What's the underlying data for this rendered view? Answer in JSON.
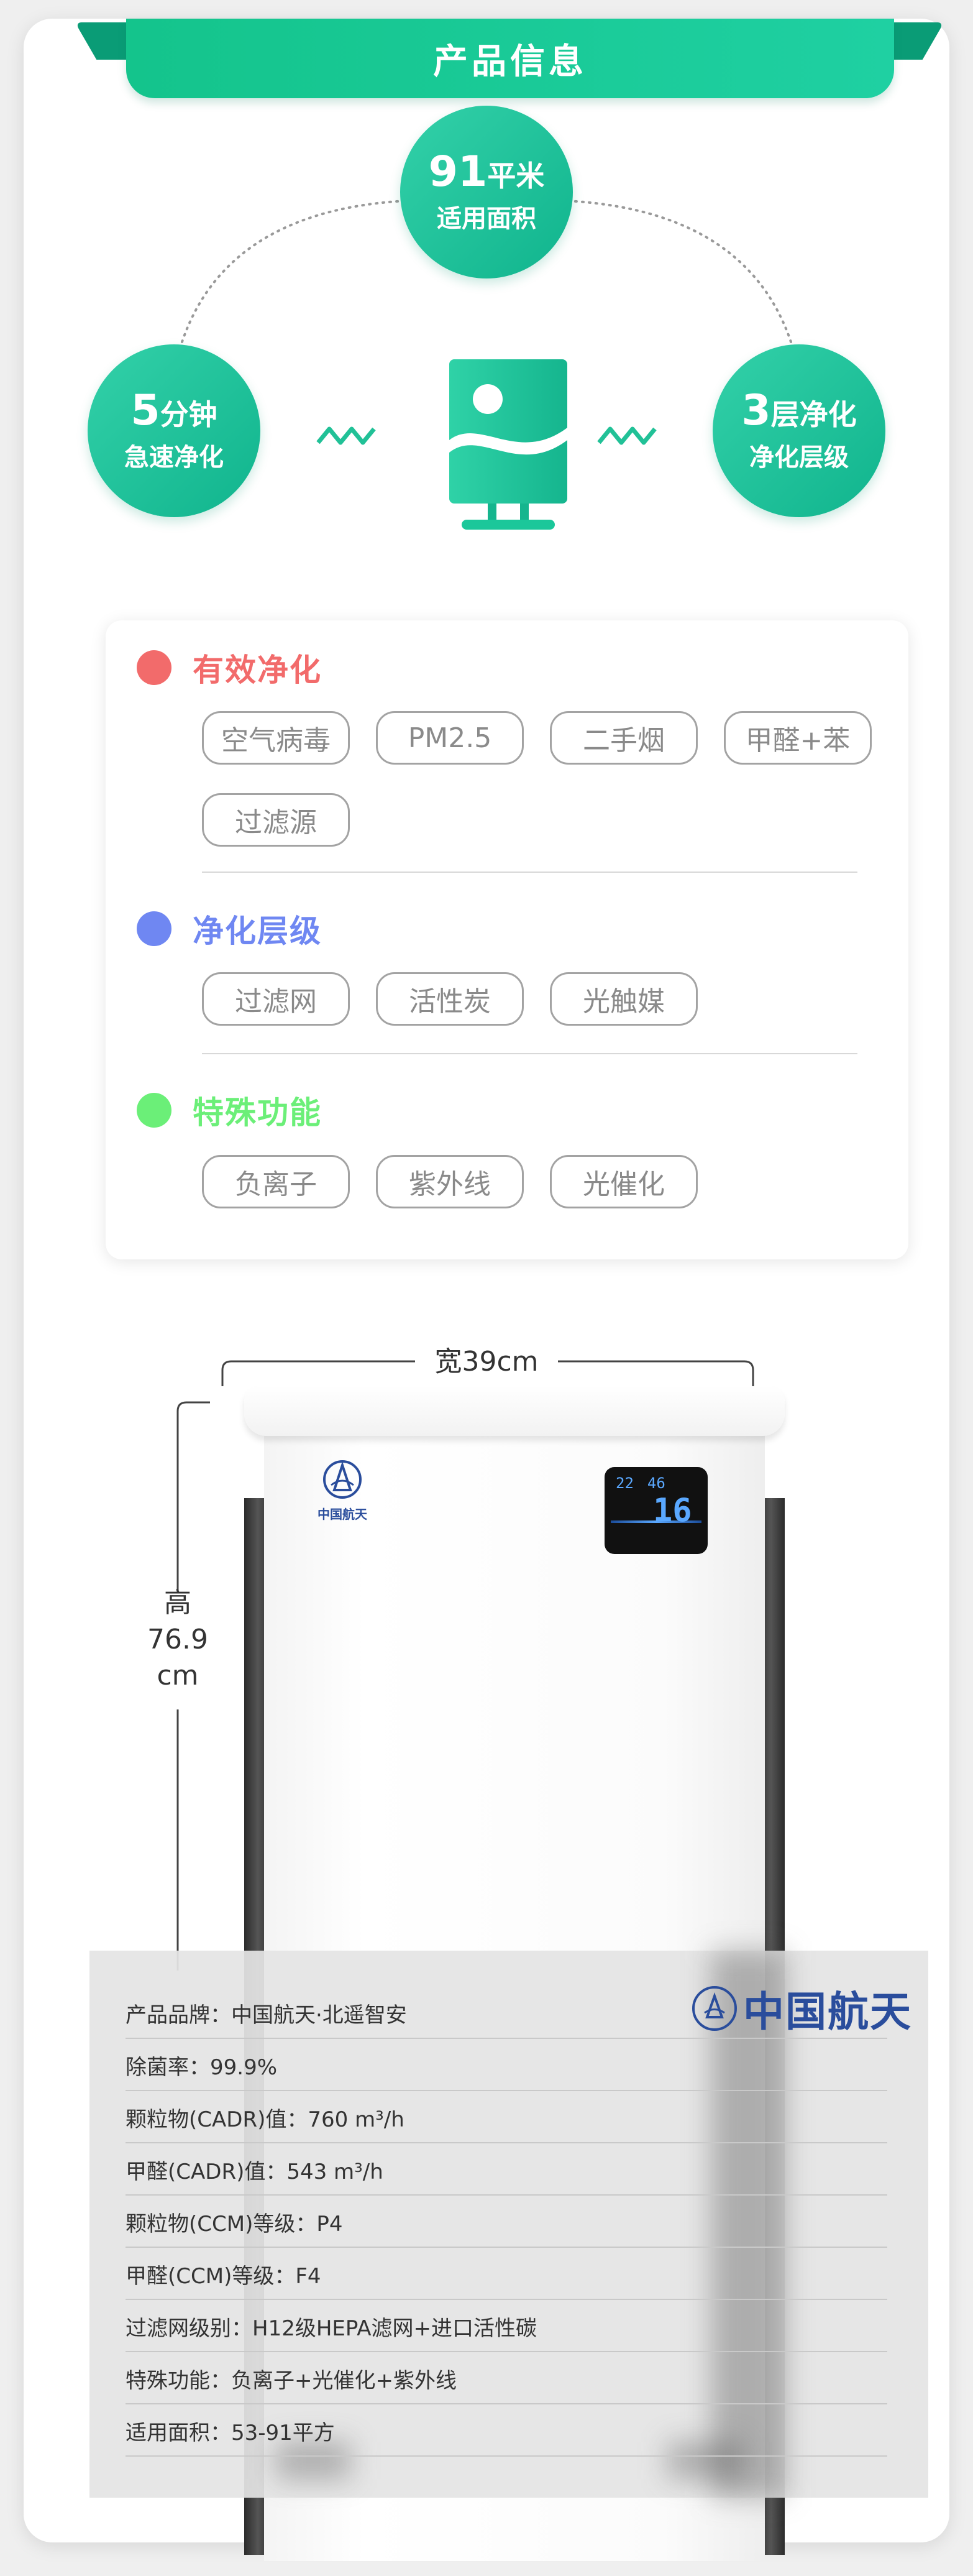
{
  "header": {
    "title": "产品信息"
  },
  "highlights": [
    {
      "big": "91",
      "big_unit": "平米",
      "sub": "适用面积"
    },
    {
      "big": "5",
      "big_unit": "分钟",
      "sub": "急速净化"
    },
    {
      "big": "3",
      "big_unit": "层净化",
      "sub": "净化层级"
    }
  ],
  "features": {
    "categories": [
      {
        "name": "有效净化",
        "color": "#f26b6b",
        "tags": [
          "空气病毒",
          "PM2.5",
          "二手烟",
          "甲醛+苯",
          "过滤源"
        ]
      },
      {
        "name": "净化层级",
        "color": "#6f87f2",
        "tags": [
          "过滤网",
          "活性炭",
          "光触媒"
        ]
      },
      {
        "name": "特殊功能",
        "color": "#6bef78",
        "tags": [
          "负离子",
          "紫外线",
          "光催化"
        ]
      }
    ]
  },
  "dimensions": {
    "width_label": "宽39cm",
    "height_label": [
      "高",
      "76.9",
      "cm"
    ]
  },
  "device": {
    "logo_text": "中国航天",
    "display": {
      "temp": "22",
      "humidity": "46",
      "main": "16"
    }
  },
  "spec": {
    "brand_logo": "中国航天",
    "rows": [
      "产品品牌：中国航天·北遥智安",
      "除菌率：99.9%",
      "颗粒物(CADR)值：760 m³/h",
      "甲醛(CADR)值：543 m³/h",
      "颗粒物(CCM)等级：P4",
      "甲醛(CCM)等级：F4",
      "过滤网级别：H12级HEPA滤网+进口活性碳",
      "特殊功能：负离子+光催化+紫外线",
      "适用面积：53-91平方"
    ]
  },
  "colors": {
    "accent": "#1bc79a",
    "brand_blue": "#2a4d9c"
  }
}
